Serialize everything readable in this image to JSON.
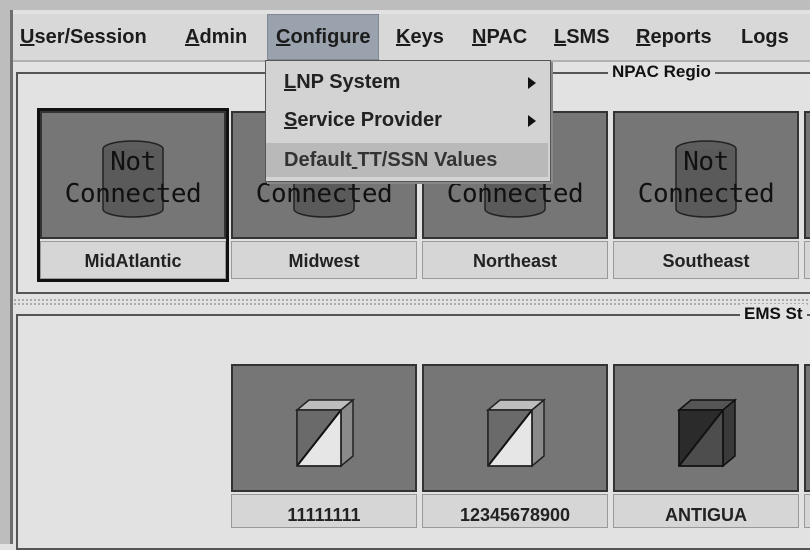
{
  "menubar": {
    "items": [
      {
        "mnemonic": "U",
        "rest": "ser/Session"
      },
      {
        "mnemonic": "A",
        "rest": "dmin"
      },
      {
        "mnemonic": "C",
        "rest": "onfigure"
      },
      {
        "mnemonic": "K",
        "rest": "eys"
      },
      {
        "mnemonic": "N",
        "rest": "PAC"
      },
      {
        "mnemonic": "L",
        "rest": "SMS"
      },
      {
        "mnemonic": "R",
        "rest": "eports"
      },
      {
        "mnemonic": "",
        "rest": "Logs"
      }
    ]
  },
  "configure_menu": {
    "items": [
      {
        "pre": "",
        "mnemonic": "L",
        "post": "NP System",
        "submenu": true
      },
      {
        "pre": "",
        "mnemonic": "S",
        "post": "ervice Provider",
        "submenu": true
      },
      {
        "pre": "Default",
        "mnemonic": " ",
        "post": "TT/SSN Values",
        "submenu": false
      }
    ]
  },
  "npac_regions": {
    "title": "NPAC Regio",
    "status_line1": "Not",
    "status_line2": "Connected",
    "tiles": [
      {
        "label": "MidAtlantic"
      },
      {
        "label": "Midwest"
      },
      {
        "label": "Northeast"
      },
      {
        "label": "Southeast"
      }
    ]
  },
  "ems_status": {
    "title": "EMS St",
    "tiles": [
      {
        "label": "11111111"
      },
      {
        "label": "12345678900"
      },
      {
        "label": "ANTIGUA"
      }
    ]
  }
}
